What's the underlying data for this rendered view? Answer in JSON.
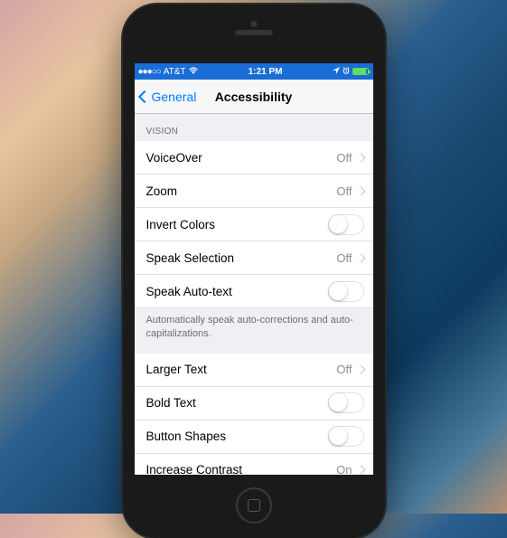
{
  "status": {
    "carrier": "AT&T",
    "time": "1:21 PM",
    "signal_dots": "●●●○○"
  },
  "nav": {
    "back_label": "General",
    "title": "Accessibility"
  },
  "section1": {
    "header": "VISION",
    "items": [
      {
        "label": "VoiceOver",
        "value": "Off",
        "type": "link"
      },
      {
        "label": "Zoom",
        "value": "Off",
        "type": "link"
      },
      {
        "label": "Invert Colors",
        "type": "toggle",
        "on": false
      },
      {
        "label": "Speak Selection",
        "value": "Off",
        "type": "link"
      },
      {
        "label": "Speak Auto-text",
        "type": "toggle",
        "on": false
      }
    ],
    "footer": "Automatically speak auto-corrections and auto-capitalizations."
  },
  "section2": {
    "items": [
      {
        "label": "Larger Text",
        "value": "Off",
        "type": "link"
      },
      {
        "label": "Bold Text",
        "type": "toggle",
        "on": false
      },
      {
        "label": "Button Shapes",
        "type": "toggle",
        "on": false
      },
      {
        "label": "Increase Contrast",
        "value": "On",
        "type": "link"
      }
    ]
  }
}
